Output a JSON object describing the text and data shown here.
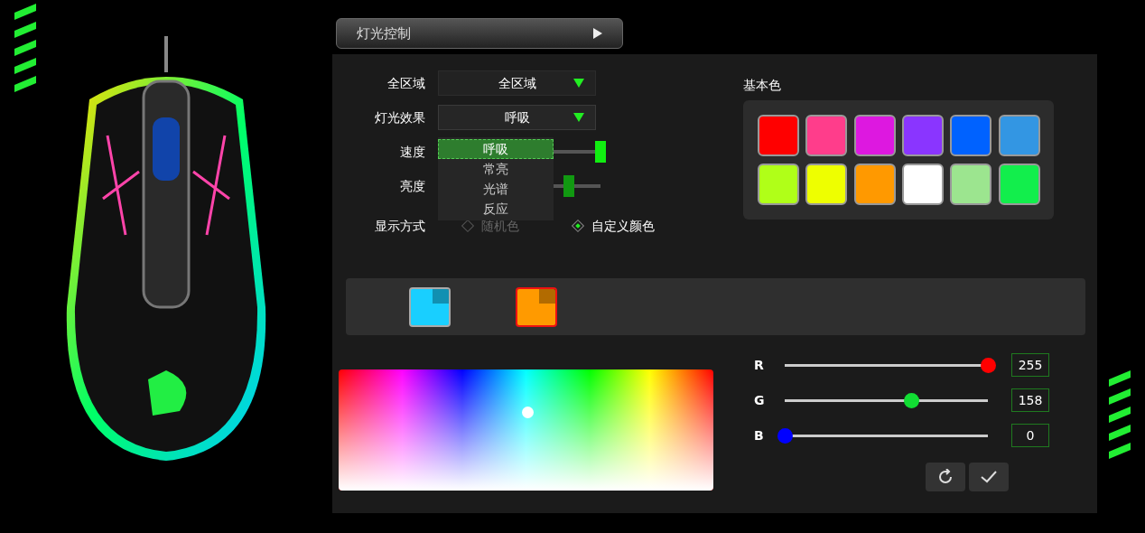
{
  "header": {
    "title": "灯光控制"
  },
  "settings": {
    "zone": {
      "label": "全区域",
      "value": "全区域"
    },
    "effect": {
      "label": "灯光效果",
      "value": "呼吸",
      "expanded": true,
      "options": [
        {
          "label": "呼吸",
          "selected": true
        },
        {
          "label": "常亮",
          "selected": false
        },
        {
          "label": "光谱",
          "selected": false
        },
        {
          "label": "反应",
          "selected": false
        }
      ]
    },
    "speed": {
      "label": "速度",
      "level": 1
    },
    "brightness": {
      "label": "亮度",
      "level": 0.8
    },
    "display_mode": {
      "label": "显示方式",
      "options": [
        {
          "label": "随机色",
          "selected": false
        },
        {
          "label": "自定义颜色",
          "selected": true
        }
      ]
    }
  },
  "basic_colors": {
    "title": "基本色",
    "swatches": [
      {
        "color": "#ff0000"
      },
      {
        "color": "#ff3d8b"
      },
      {
        "color": "#dd18e0"
      },
      {
        "color": "#8a35ff"
      },
      {
        "color": "#0062ff"
      },
      {
        "color": "#3396e3"
      },
      {
        "color": "#b0ff18"
      },
      {
        "color": "#eeff00"
      },
      {
        "color": "#ff9900"
      },
      {
        "color": "#ffffff"
      },
      {
        "color": "#9ce58f"
      },
      {
        "color": "#12ee4c"
      }
    ]
  },
  "color_slots": [
    {
      "color": "#19cfff",
      "selected": false
    },
    {
      "color": "#ff9a00",
      "selected": true
    }
  ],
  "rgb": [
    {
      "label": "R",
      "level": 1,
      "value": "255",
      "color": "#ff0000"
    },
    {
      "label": "G",
      "level": 0.62,
      "value": "158",
      "color": "#11dd33"
    },
    {
      "label": "B",
      "level": 0,
      "value": "0",
      "color": "#0000ff"
    }
  ]
}
